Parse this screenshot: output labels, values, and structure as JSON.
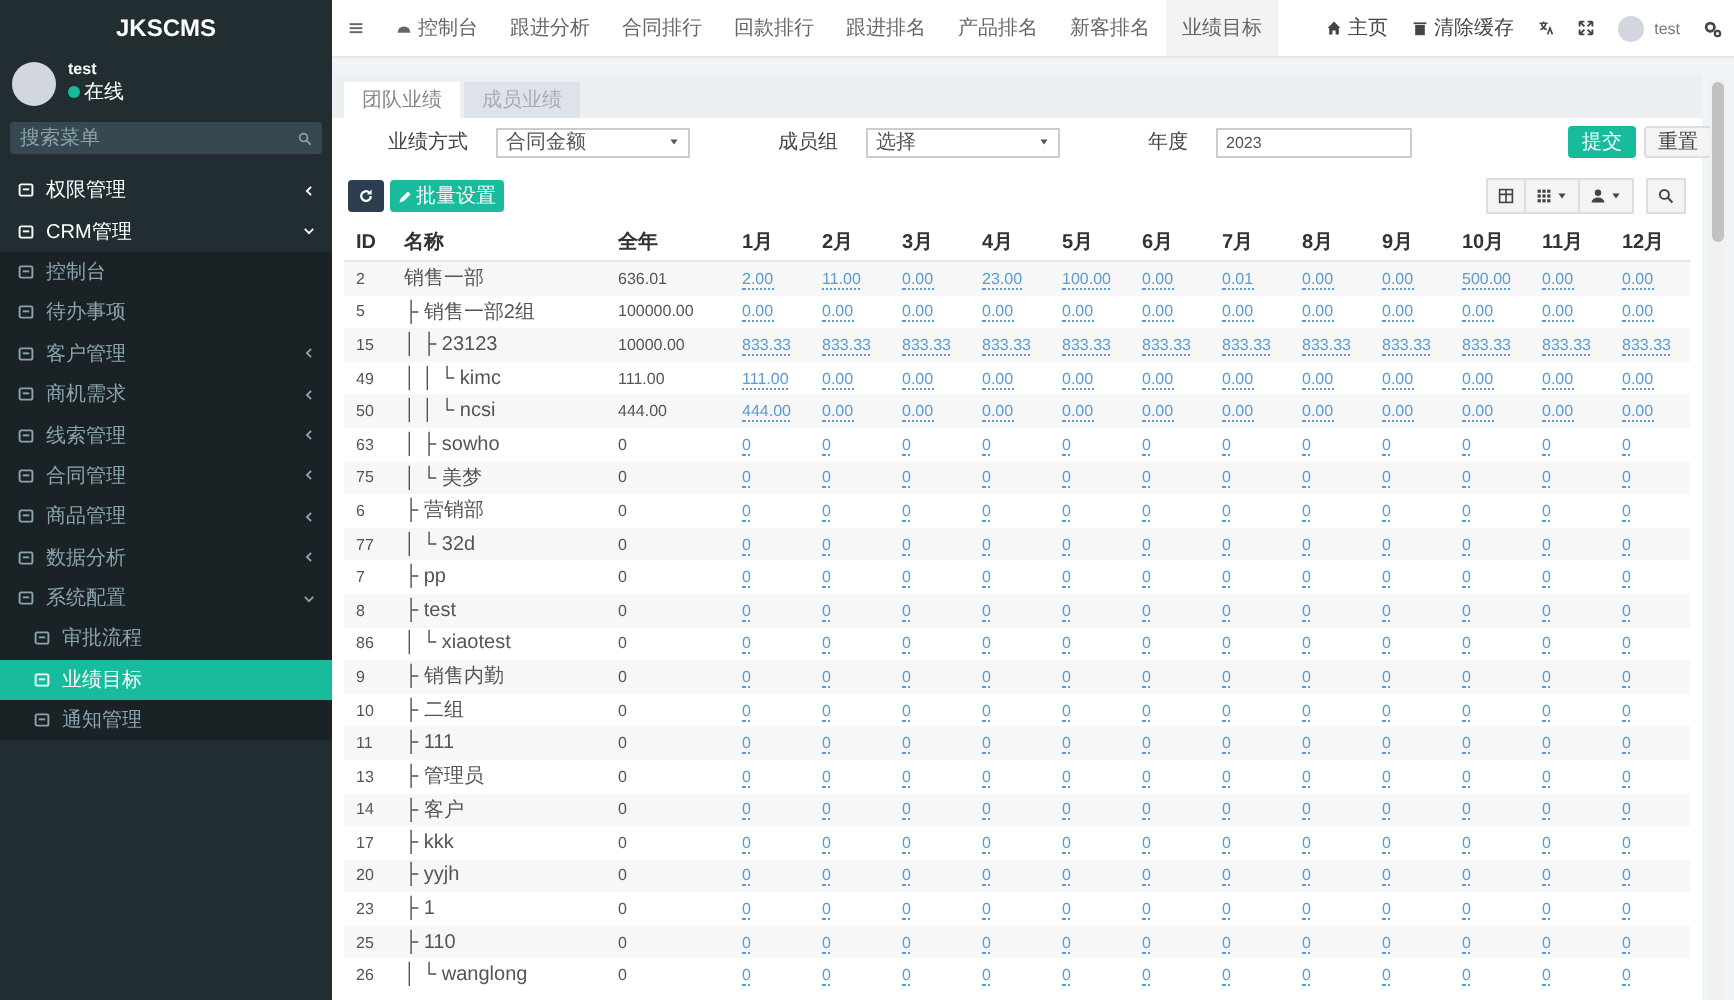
{
  "sidebar": {
    "logo": "JKSCMS",
    "user": {
      "name": "test",
      "status": "在线"
    },
    "search": {
      "placeholder": "搜索菜单"
    },
    "items": [
      {
        "label": "权限管理",
        "kind": "group",
        "expanded": false,
        "selected": false
      },
      {
        "label": "CRM管理",
        "kind": "group",
        "expanded": true,
        "selected": false,
        "children": [
          {
            "label": "控制台",
            "kind": "link",
            "selected": false
          },
          {
            "label": "待办事项",
            "kind": "link",
            "selected": false
          },
          {
            "label": "客户管理",
            "kind": "group",
            "expanded": false,
            "selected": false
          },
          {
            "label": "商机需求",
            "kind": "group",
            "expanded": false,
            "selected": false
          },
          {
            "label": "线索管理",
            "kind": "group",
            "expanded": false,
            "selected": false
          },
          {
            "label": "合同管理",
            "kind": "group",
            "expanded": false,
            "selected": false
          },
          {
            "label": "商品管理",
            "kind": "group",
            "expanded": false,
            "selected": false
          },
          {
            "label": "数据分析",
            "kind": "group",
            "expanded": false,
            "selected": false
          },
          {
            "label": "系统配置",
            "kind": "group",
            "expanded": true,
            "selected": false,
            "children": [
              {
                "label": "审批流程",
                "kind": "link",
                "selected": false
              },
              {
                "label": "业绩目标",
                "kind": "link",
                "selected": true
              },
              {
                "label": "通知管理",
                "kind": "link",
                "selected": false
              }
            ]
          }
        ]
      }
    ]
  },
  "topbar": {
    "nav": [
      {
        "label": "控制台",
        "selected": false
      },
      {
        "label": "跟进分析",
        "selected": false
      },
      {
        "label": "合同排行",
        "selected": false
      },
      {
        "label": "回款排行",
        "selected": false
      },
      {
        "label": "跟进排名",
        "selected": false
      },
      {
        "label": "产品排名",
        "selected": false
      },
      {
        "label": "新客排名",
        "selected": false
      },
      {
        "label": "业绩目标",
        "selected": true
      }
    ],
    "links": [
      {
        "label": "主页"
      },
      {
        "label": "清除缓存"
      }
    ],
    "user": "test"
  },
  "tabs": [
    {
      "label": "团队业绩",
      "selected": true
    },
    {
      "label": "成员业绩",
      "selected": false
    }
  ],
  "filters": [
    {
      "kind": "select",
      "label": "业绩方式",
      "value": "合同金额"
    },
    {
      "kind": "select",
      "label": "成员组",
      "value": "选择"
    },
    {
      "kind": "input",
      "label": "年度",
      "value": "2023"
    }
  ],
  "actions": [
    {
      "label": "提交",
      "kind": "primary"
    },
    {
      "label": "重置",
      "kind": "default"
    }
  ],
  "toolbar": {
    "batch_button": "批量设置"
  },
  "table": {
    "columns": [
      "ID",
      "名称",
      "全年",
      "1月",
      "2月",
      "3月",
      "4月",
      "5月",
      "6月",
      "7月",
      "8月",
      "9月",
      "10月",
      "11月",
      "12月"
    ],
    "rows": [
      {
        "id": "2",
        "name": "销售一部",
        "year": "636.01",
        "months": [
          "2.00",
          "11.00",
          "0.00",
          "23.00",
          "100.00",
          "0.00",
          "0.01",
          "0.00",
          "0.00",
          "500.00",
          "0.00",
          "0.00"
        ]
      },
      {
        "id": "5",
        "name": "├ 销售一部2组",
        "year": "100000.00",
        "months": [
          "0.00",
          "0.00",
          "0.00",
          "0.00",
          "0.00",
          "0.00",
          "0.00",
          "0.00",
          "0.00",
          "0.00",
          "0.00",
          "0.00"
        ]
      },
      {
        "id": "15",
        "name": "│ ├ 23123",
        "year": "10000.00",
        "months": [
          "833.33",
          "833.33",
          "833.33",
          "833.33",
          "833.33",
          "833.33",
          "833.33",
          "833.33",
          "833.33",
          "833.33",
          "833.33",
          "833.33"
        ]
      },
      {
        "id": "49",
        "name": "│ │ └ kimc",
        "year": "111.00",
        "months": [
          "111.00",
          "0.00",
          "0.00",
          "0.00",
          "0.00",
          "0.00",
          "0.00",
          "0.00",
          "0.00",
          "0.00",
          "0.00",
          "0.00"
        ]
      },
      {
        "id": "50",
        "name": "│ │   └ ncsi",
        "year": "444.00",
        "months": [
          "444.00",
          "0.00",
          "0.00",
          "0.00",
          "0.00",
          "0.00",
          "0.00",
          "0.00",
          "0.00",
          "0.00",
          "0.00",
          "0.00"
        ]
      },
      {
        "id": "63",
        "name": "│ ├ sowho",
        "year": "0",
        "months": [
          "0",
          "0",
          "0",
          "0",
          "0",
          "0",
          "0",
          "0",
          "0",
          "0",
          "0",
          "0"
        ]
      },
      {
        "id": "75",
        "name": "│ └ 美梦",
        "year": "0",
        "months": [
          "0",
          "0",
          "0",
          "0",
          "0",
          "0",
          "0",
          "0",
          "0",
          "0",
          "0",
          "0"
        ]
      },
      {
        "id": "6",
        "name": "├ 营销部",
        "year": "0",
        "months": [
          "0",
          "0",
          "0",
          "0",
          "0",
          "0",
          "0",
          "0",
          "0",
          "0",
          "0",
          "0"
        ]
      },
      {
        "id": "77",
        "name": "│ └ 32d",
        "year": "0",
        "months": [
          "0",
          "0",
          "0",
          "0",
          "0",
          "0",
          "0",
          "0",
          "0",
          "0",
          "0",
          "0"
        ]
      },
      {
        "id": "7",
        "name": "├ pp",
        "year": "0",
        "months": [
          "0",
          "0",
          "0",
          "0",
          "0",
          "0",
          "0",
          "0",
          "0",
          "0",
          "0",
          "0"
        ]
      },
      {
        "id": "8",
        "name": "├ test",
        "year": "0",
        "months": [
          "0",
          "0",
          "0",
          "0",
          "0",
          "0",
          "0",
          "0",
          "0",
          "0",
          "0",
          "0"
        ]
      },
      {
        "id": "86",
        "name": "│ └ xiaotest",
        "year": "0",
        "months": [
          "0",
          "0",
          "0",
          "0",
          "0",
          "0",
          "0",
          "0",
          "0",
          "0",
          "0",
          "0"
        ]
      },
      {
        "id": "9",
        "name": "├ 销售内勤",
        "year": "0",
        "months": [
          "0",
          "0",
          "0",
          "0",
          "0",
          "0",
          "0",
          "0",
          "0",
          "0",
          "0",
          "0"
        ]
      },
      {
        "id": "10",
        "name": "├ 二组",
        "year": "0",
        "months": [
          "0",
          "0",
          "0",
          "0",
          "0",
          "0",
          "0",
          "0",
          "0",
          "0",
          "0",
          "0"
        ]
      },
      {
        "id": "11",
        "name": "├ 111",
        "year": "0",
        "months": [
          "0",
          "0",
          "0",
          "0",
          "0",
          "0",
          "0",
          "0",
          "0",
          "0",
          "0",
          "0"
        ]
      },
      {
        "id": "13",
        "name": "├ 管理员",
        "year": "0",
        "months": [
          "0",
          "0",
          "0",
          "0",
          "0",
          "0",
          "0",
          "0",
          "0",
          "0",
          "0",
          "0"
        ]
      },
      {
        "id": "14",
        "name": "├ 客户",
        "year": "0",
        "months": [
          "0",
          "0",
          "0",
          "0",
          "0",
          "0",
          "0",
          "0",
          "0",
          "0",
          "0",
          "0"
        ]
      },
      {
        "id": "17",
        "name": "├ kkk",
        "year": "0",
        "months": [
          "0",
          "0",
          "0",
          "0",
          "0",
          "0",
          "0",
          "0",
          "0",
          "0",
          "0",
          "0"
        ]
      },
      {
        "id": "20",
        "name": "├ yyjh",
        "year": "0",
        "months": [
          "0",
          "0",
          "0",
          "0",
          "0",
          "0",
          "0",
          "0",
          "0",
          "0",
          "0",
          "0"
        ]
      },
      {
        "id": "23",
        "name": "├ 1",
        "year": "0",
        "months": [
          "0",
          "0",
          "0",
          "0",
          "0",
          "0",
          "0",
          "0",
          "0",
          "0",
          "0",
          "0"
        ]
      },
      {
        "id": "25",
        "name": "├ 110",
        "year": "0",
        "months": [
          "0",
          "0",
          "0",
          "0",
          "0",
          "0",
          "0",
          "0",
          "0",
          "0",
          "0",
          "0"
        ]
      },
      {
        "id": "26",
        "name": "│ └ wanglong",
        "year": "0",
        "months": [
          "0",
          "0",
          "0",
          "0",
          "0",
          "0",
          "0",
          "0",
          "0",
          "0",
          "0",
          "0"
        ]
      }
    ]
  }
}
